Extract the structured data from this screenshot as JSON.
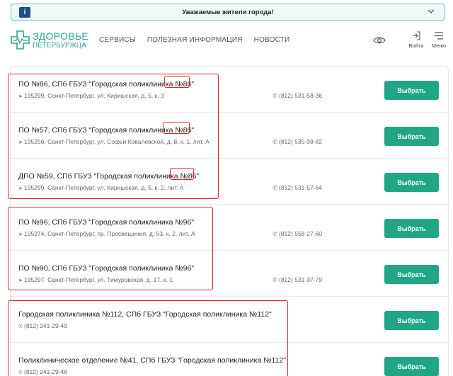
{
  "notice": {
    "text": "Уважаемые жители города!",
    "info_icon": "i"
  },
  "logo": {
    "line1": "ЗДОРОВЬЕ",
    "line2": "ПЕТЕРБУРЖЦА"
  },
  "nav": [
    "СЕРВИСЫ",
    "ПОЛЕЗНАЯ ИНФОРМАЦИЯ",
    "НОВОСТИ"
  ],
  "header_buttons": {
    "login": "Войти",
    "menu": "Меню"
  },
  "colors": {
    "accent": "#21a685",
    "brand": "#2aa58e",
    "highlight": "#d9262b"
  },
  "clinics": [
    {
      "title": "ПО №86, СПб ГБУЗ \"Городская поликлиника №86\"",
      "address": "195299, Санкт-Петербург, ул. Киришская, д. 5, к. 3",
      "phone": "(812) 531-58-36",
      "button": "Выбрать"
    },
    {
      "title": "ПО №57, СПб ГБУЗ \"Городская поликлиника №86\"",
      "address": "195256, Санкт-Петербург, ул. Софьи Ковалевской, д. 8, к. 1, лит. А",
      "phone": "(812) 535-98-82",
      "button": "Выбрать"
    },
    {
      "title": "ДПО №59, СПб ГБУЗ \"Городская поликлиника №86\"",
      "address": "195299, Санкт-Петербург, ул. Киришская, д. 5, к. 2, лит. А",
      "phone": "(812) 531-57-64",
      "button": "Выбрать"
    },
    {
      "title": "ПО №96, СПб ГБУЗ \"Городская поликлиника №96\"",
      "address": "195274, Санкт-Петербург, пр. Просвещения, д. 53, к. 2, лит. А",
      "phone": "(812) 558-27-60",
      "button": "Выбрать"
    },
    {
      "title": "ПО №90, СПб ГБУЗ \"Городская поликлиника №96\"",
      "address": "195297, Санкт-Петербург, ул. Тимуровская, д. 17, к. 1",
      "phone": "(812) 531-37-79",
      "button": "Выбрать"
    },
    {
      "title": "Городская поликлиника №112, СПб ГБУЗ \"Городская поликлиника №112\"",
      "phone": "(812) 241-29-49",
      "button": "Выбрать"
    },
    {
      "title": "Поликлиническое отделение №41, СПб ГБУЗ \"Городская поликлиника №112\"",
      "phone": "(812) 241-29-48",
      "button": "Выбрать"
    }
  ]
}
